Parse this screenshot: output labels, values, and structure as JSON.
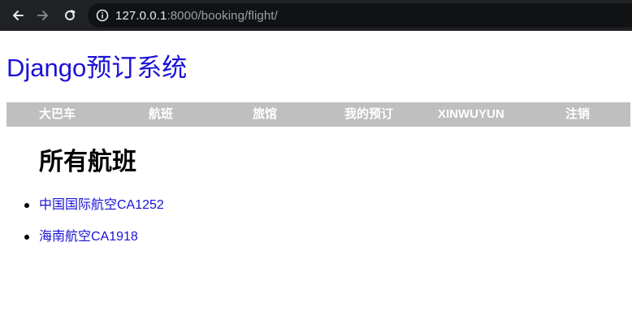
{
  "browser": {
    "url_host": "127.0.0.1",
    "url_rest": ":8000/booking/flight/"
  },
  "site": {
    "title": "Django预订系统"
  },
  "nav": {
    "items": [
      {
        "label": "大巴车"
      },
      {
        "label": "航班"
      },
      {
        "label": "旅馆"
      },
      {
        "label": "我的预订"
      },
      {
        "label": "XINWUYUN"
      },
      {
        "label": "注销"
      }
    ]
  },
  "main": {
    "heading": "所有航班",
    "flights": [
      {
        "label": "中国国际航空CA1252"
      },
      {
        "label": "海南航空CA1918"
      }
    ]
  },
  "colors": {
    "link": "#1b12d6",
    "navbar_bg": "#bfbfbf",
    "browser_bg": "#202124"
  }
}
